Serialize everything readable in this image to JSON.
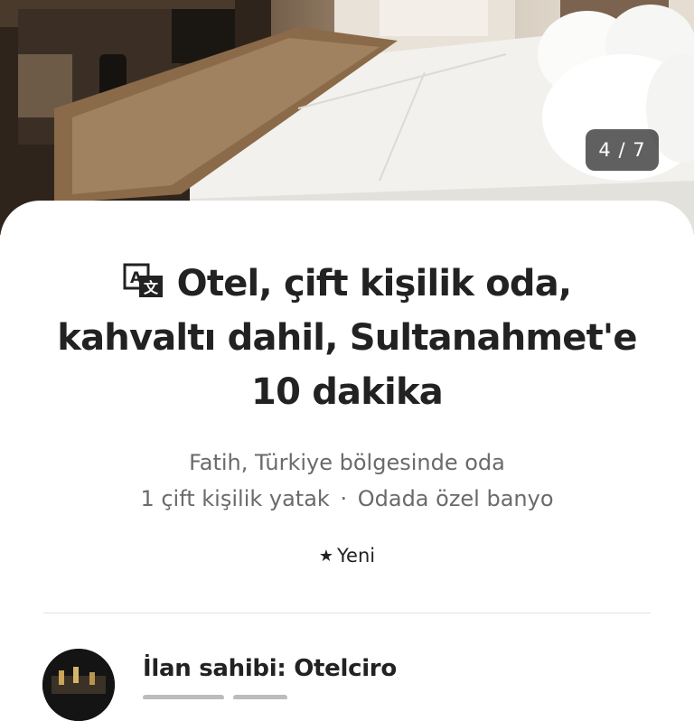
{
  "gallery": {
    "counter": "4 / 7",
    "photo_alt": "Hotel room with double bed"
  },
  "listing": {
    "title": "Otel, çift kişilik oda, kahvaltı dahil, Sultanahmet'e 10 dakika",
    "location": "Fatih, Türkiye bölgesinde oda",
    "bed": "1 çift kişilik yatak",
    "separator": "·",
    "bath": "Odada özel banyo",
    "rating_label": "Yeni",
    "rating_icon": "star-icon",
    "translate_icon": "translate-icon"
  },
  "host": {
    "label": "İlan sahibi: Otelciro"
  },
  "colors": {
    "text": "#222222",
    "secondary": "#6a6a6a",
    "divider": "#e2e2e2"
  }
}
